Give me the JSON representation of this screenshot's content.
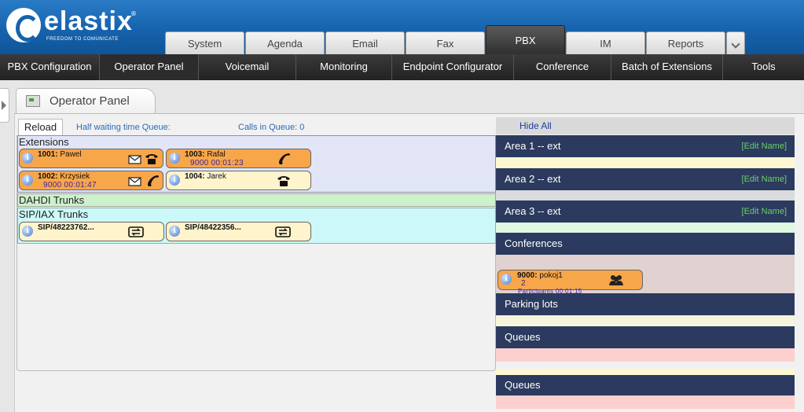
{
  "logo": {
    "brand": "elastix",
    "tagline": "FREEDOM TO COMUNICATE",
    "reg": "®"
  },
  "top_tabs": [
    {
      "label": "System",
      "active": false
    },
    {
      "label": "Agenda",
      "active": false
    },
    {
      "label": "Email",
      "active": false
    },
    {
      "label": "Fax",
      "active": false
    },
    {
      "label": "PBX",
      "active": true
    },
    {
      "label": "IM",
      "active": false
    },
    {
      "label": "Reports",
      "active": false
    }
  ],
  "sub_nav": [
    {
      "label": "PBX Configuration"
    },
    {
      "label": "Operator Panel"
    },
    {
      "label": "Voicemail"
    },
    {
      "label": "Monitoring"
    },
    {
      "label": "Endpoint Configurator"
    },
    {
      "label": "Conference"
    },
    {
      "label": "Batch of Extensions"
    },
    {
      "label": "Tools"
    }
  ],
  "panel": {
    "title": "Operator Panel"
  },
  "toolbar": {
    "reload_label": "Reload",
    "half_waiting_label": "Half waiting time Queue:",
    "calls_in_queue_label": "Calls in Queue: 0",
    "hide_all_label": "Hide All"
  },
  "sections": {
    "extensions": "Extensions",
    "dahdi": "DAHDI Trunks",
    "sip": "SIP/IAX Trunks"
  },
  "extensions": [
    {
      "number": "1001:",
      "name": "Pawel",
      "detail": "",
      "icons": [
        "envelope-icon",
        "desk-phone-icon"
      ],
      "state": "busy"
    },
    {
      "number": "1003:",
      "name": "Rafal",
      "detail": "9000   00:01:23",
      "icons": [
        "handset-icon"
      ],
      "state": "busy"
    },
    {
      "number": "1002:",
      "name": "Krzysiek",
      "detail": "9000   00:01:47",
      "icons": [
        "envelope-icon",
        "handset-icon"
      ],
      "state": "busy"
    },
    {
      "number": "1004:",
      "name": "Jarek",
      "detail": "",
      "icons": [
        "desk-phone-icon"
      ],
      "state": "idle"
    }
  ],
  "trunks": [
    {
      "label": "SIP/48223762...",
      "icon": "trunk-icon"
    },
    {
      "label": "SIP/48422356...",
      "icon": "trunk-icon"
    }
  ],
  "right_panels": [
    {
      "title": "Area 1 -- ext",
      "edit": "[Edit Name]"
    },
    {
      "title": "Area 2 -- ext",
      "edit": "[Edit Name]"
    },
    {
      "title": "Area 3 -- ext",
      "edit": "[Edit Name]"
    },
    {
      "title": "Conferences"
    },
    {
      "title": "Parking lots"
    },
    {
      "title": "Queues"
    },
    {
      "title": "Queues"
    }
  ],
  "conference": {
    "number": "9000:",
    "name": "pokoj1",
    "count": "2",
    "participants": "Participants    00:01:15",
    "icon": "group-icon"
  }
}
